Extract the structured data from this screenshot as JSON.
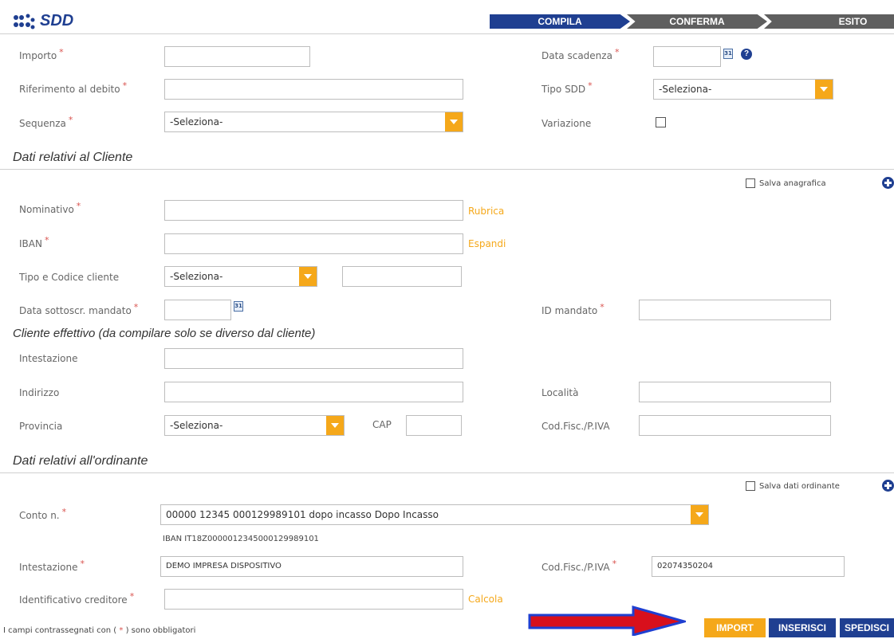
{
  "header": {
    "title": "SDD"
  },
  "steps": [
    "COMPILA",
    "CONFERMA",
    "ESITO"
  ],
  "colors": {
    "accent": "#f5a81a",
    "brand": "#1f3f91",
    "required": "#d9534f",
    "step_inactive": "#5f5f5f"
  },
  "top": {
    "importo": {
      "label": "Importo",
      "value": ""
    },
    "riferimento": {
      "label": "Riferimento al debito",
      "value": ""
    },
    "sequenza": {
      "label": "Sequenza",
      "value": "-Seleziona-"
    },
    "data_scadenza": {
      "label": "Data scadenza",
      "value": "",
      "calendar_icon": "calendar-icon",
      "help_icon": "help-icon"
    },
    "tipo_sdd": {
      "label": "Tipo SDD",
      "value": "-Seleziona-"
    },
    "variazione": {
      "label": "Variazione",
      "checked": false
    }
  },
  "cliente": {
    "title": "Dati relativi al Cliente",
    "salva_anagrafica": "Salva anagrafica",
    "nominativo": {
      "label": "Nominativo",
      "value": "",
      "link": "Rubrica"
    },
    "iban": {
      "label": "IBAN",
      "value": "",
      "link": "Espandi"
    },
    "tipo_codice": {
      "label": "Tipo e Codice cliente",
      "value": "-Seleziona-",
      "codice": ""
    },
    "data_sottoscr": {
      "label": "Data sottoscr. mandato",
      "value": ""
    },
    "id_mandato": {
      "label": "ID mandato",
      "value": ""
    }
  },
  "effettivo": {
    "title": "Cliente effettivo (da compilare solo se diverso dal cliente)",
    "intestazione": {
      "label": "Intestazione",
      "value": ""
    },
    "indirizzo": {
      "label": "Indirizzo",
      "value": ""
    },
    "localita": {
      "label": "Località",
      "value": ""
    },
    "provincia": {
      "label": "Provincia",
      "value": "-Seleziona-"
    },
    "cap": {
      "label": "CAP",
      "value": ""
    },
    "codfisc": {
      "label": "Cod.Fisc./P.IVA",
      "value": ""
    }
  },
  "ordinante": {
    "title": "Dati relativi all'ordinante",
    "salva_dati": "Salva dati ordinante",
    "conto": {
      "label": "Conto n.",
      "value": "00000 12345 000129989101 dopo incasso Dopo Incasso"
    },
    "iban_info": "IBAN IT18Z0000012345000129989101",
    "intestazione": {
      "label": "Intestazione",
      "value": "DEMO IMPRESA DISPOSITIVO"
    },
    "codfisc": {
      "label": "Cod.Fisc./P.IVA",
      "value": "02074350204"
    },
    "identificativo": {
      "label": "Identificativo creditore",
      "value": "",
      "link": "Calcola"
    }
  },
  "footer": {
    "note_before": "I campi contrassegnati con (",
    "note_star": "*",
    "note_after": ") sono obbligatori",
    "buttons": {
      "import": "IMPORT",
      "inserisci": "INSERISCI",
      "spedisci": "SPEDISCI"
    }
  }
}
